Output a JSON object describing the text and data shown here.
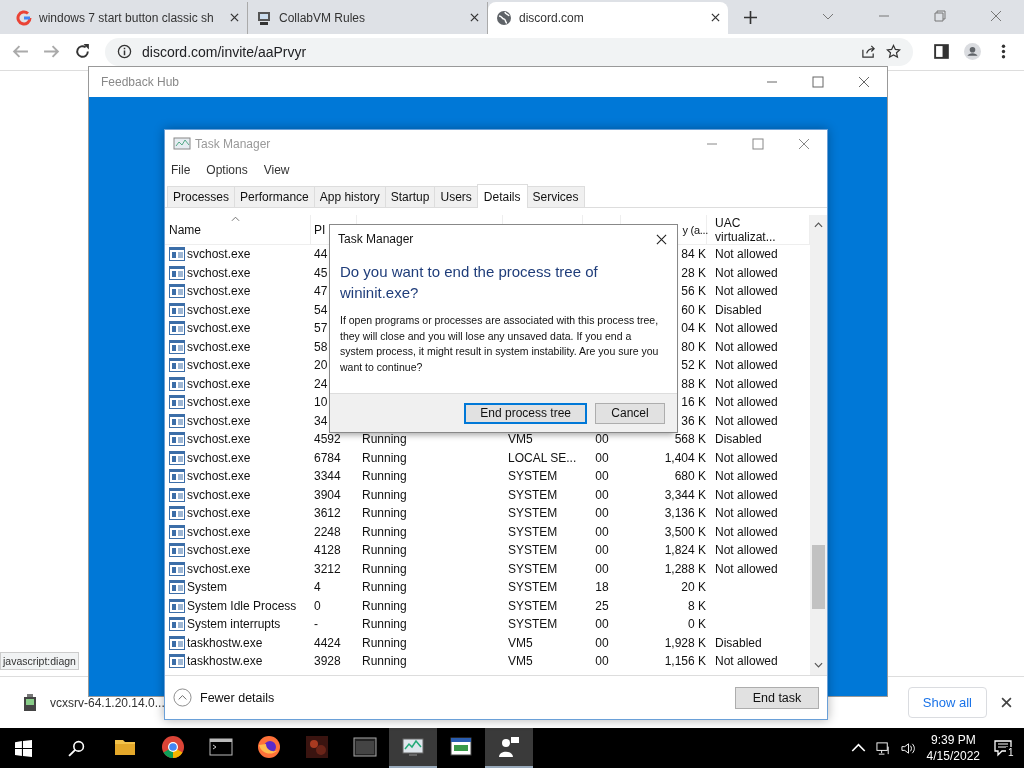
{
  "browser": {
    "tabs": [
      {
        "title": "windows 7 start button classic sh",
        "kind": "rings",
        "selected": false
      },
      {
        "title": "CollabVM Rules",
        "kind": "computer",
        "selected": false
      },
      {
        "title": "discord.com",
        "kind": "globe",
        "selected": true
      }
    ],
    "url": "discord.com/invite/aaPrvyr"
  },
  "status_link": "javascript:diagn",
  "feedback_hub": {
    "title": "Feedback Hub"
  },
  "task_manager": {
    "title": "Task Manager",
    "menu": [
      "File",
      "Options",
      "View"
    ],
    "tabs": [
      {
        "label": "Processes",
        "selected": false
      },
      {
        "label": "Performance",
        "selected": false
      },
      {
        "label": "App history",
        "selected": false
      },
      {
        "label": "Startup",
        "selected": false
      },
      {
        "label": "Users",
        "selected": false
      },
      {
        "label": "Details",
        "selected": true
      },
      {
        "label": "Services",
        "selected": false
      }
    ],
    "columns": {
      "name": "Name",
      "pid": "PI",
      "memory": "y (a...",
      "uac": "UAC virtualizat..."
    },
    "rows": [
      {
        "name": "svchost.exe",
        "pid": "44",
        "memory": "84 K",
        "uac": "Not allowed"
      },
      {
        "name": "svchost.exe",
        "pid": "45",
        "memory": "28 K",
        "uac": "Not allowed"
      },
      {
        "name": "svchost.exe",
        "pid": "47",
        "memory": "56 K",
        "uac": "Not allowed"
      },
      {
        "name": "svchost.exe",
        "pid": "54",
        "memory": "60 K",
        "uac": "Disabled"
      },
      {
        "name": "svchost.exe",
        "pid": "57",
        "memory": "04 K",
        "uac": "Not allowed"
      },
      {
        "name": "svchost.exe",
        "pid": "58",
        "memory": "80 K",
        "uac": "Not allowed"
      },
      {
        "name": "svchost.exe",
        "pid": "20",
        "memory": "52 K",
        "uac": "Not allowed"
      },
      {
        "name": "svchost.exe",
        "pid": "24",
        "memory": "88 K",
        "uac": "Not allowed"
      },
      {
        "name": "svchost.exe",
        "pid": "10",
        "memory": "16 K",
        "uac": "Not allowed"
      },
      {
        "name": "svchost.exe",
        "pid": "34",
        "memory": "36 K",
        "uac": "Not allowed"
      },
      {
        "name": "svchost.exe",
        "pid": "4592",
        "status": "Running",
        "user": "VM5",
        "cpu": "00",
        "memory": "568 K",
        "uac": "Disabled"
      },
      {
        "name": "svchost.exe",
        "pid": "6784",
        "status": "Running",
        "user": "LOCAL SE...",
        "cpu": "00",
        "memory": "1,404 K",
        "uac": "Not allowed"
      },
      {
        "name": "svchost.exe",
        "pid": "3344",
        "status": "Running",
        "user": "SYSTEM",
        "cpu": "00",
        "memory": "680 K",
        "uac": "Not allowed"
      },
      {
        "name": "svchost.exe",
        "pid": "3904",
        "status": "Running",
        "user": "SYSTEM",
        "cpu": "00",
        "memory": "3,344 K",
        "uac": "Not allowed"
      },
      {
        "name": "svchost.exe",
        "pid": "3612",
        "status": "Running",
        "user": "SYSTEM",
        "cpu": "00",
        "memory": "3,136 K",
        "uac": "Not allowed"
      },
      {
        "name": "svchost.exe",
        "pid": "2248",
        "status": "Running",
        "user": "SYSTEM",
        "cpu": "00",
        "memory": "3,500 K",
        "uac": "Not allowed"
      },
      {
        "name": "svchost.exe",
        "pid": "4128",
        "status": "Running",
        "user": "SYSTEM",
        "cpu": "00",
        "memory": "1,824 K",
        "uac": "Not allowed"
      },
      {
        "name": "svchost.exe",
        "pid": "3212",
        "status": "Running",
        "user": "SYSTEM",
        "cpu": "00",
        "memory": "1,288 K",
        "uac": "Not allowed"
      },
      {
        "name": "System",
        "pid": "4",
        "status": "Running",
        "user": "SYSTEM",
        "cpu": "18",
        "memory": "20 K"
      },
      {
        "name": "System Idle Process",
        "pid": "0",
        "status": "Running",
        "user": "SYSTEM",
        "cpu": "25",
        "memory": "8 K"
      },
      {
        "name": "System interrupts",
        "pid": "-",
        "status": "Running",
        "user": "SYSTEM",
        "cpu": "00",
        "memory": "0 K"
      },
      {
        "name": "taskhostw.exe",
        "pid": "4424",
        "status": "Running",
        "user": "VM5",
        "cpu": "00",
        "memory": "1,928 K",
        "uac": "Disabled"
      },
      {
        "name": "taskhostw.exe",
        "pid": "3928",
        "status": "Running",
        "user": "VM5",
        "cpu": "00",
        "memory": "1,156 K",
        "uac": "Not allowed"
      }
    ],
    "fewer_details": "Fewer details",
    "end_task": "End task"
  },
  "dialog": {
    "title": "Task Manager",
    "heading": "Do you want to end the process tree of wininit.exe?",
    "message": "If open programs or processes are associated with this process tree, they will close and you will lose any unsaved data. If you end a system process, it might result in system instability. Are you sure you want to continue?",
    "buttons": [
      {
        "label": "End process tree",
        "default": true
      },
      {
        "label": "Cancel",
        "default": false
      }
    ]
  },
  "download_bar": {
    "file": "vcxsrv-64.1.20.14.0...",
    "show_all": "Show all"
  },
  "taskbar": {
    "apps": [
      {
        "kind": "folder",
        "active": false
      },
      {
        "kind": "chrome",
        "active": false
      },
      {
        "kind": "console",
        "active": false
      },
      {
        "kind": "firefox",
        "active": false
      },
      {
        "kind": "game",
        "active": false
      },
      {
        "kind": "terminal",
        "active": false
      },
      {
        "kind": "monitor",
        "active": true
      },
      {
        "kind": "window",
        "active": false
      },
      {
        "kind": "people",
        "active": true
      }
    ],
    "time": "9:39 PM",
    "date": "4/15/2022",
    "notifications": "1"
  }
}
